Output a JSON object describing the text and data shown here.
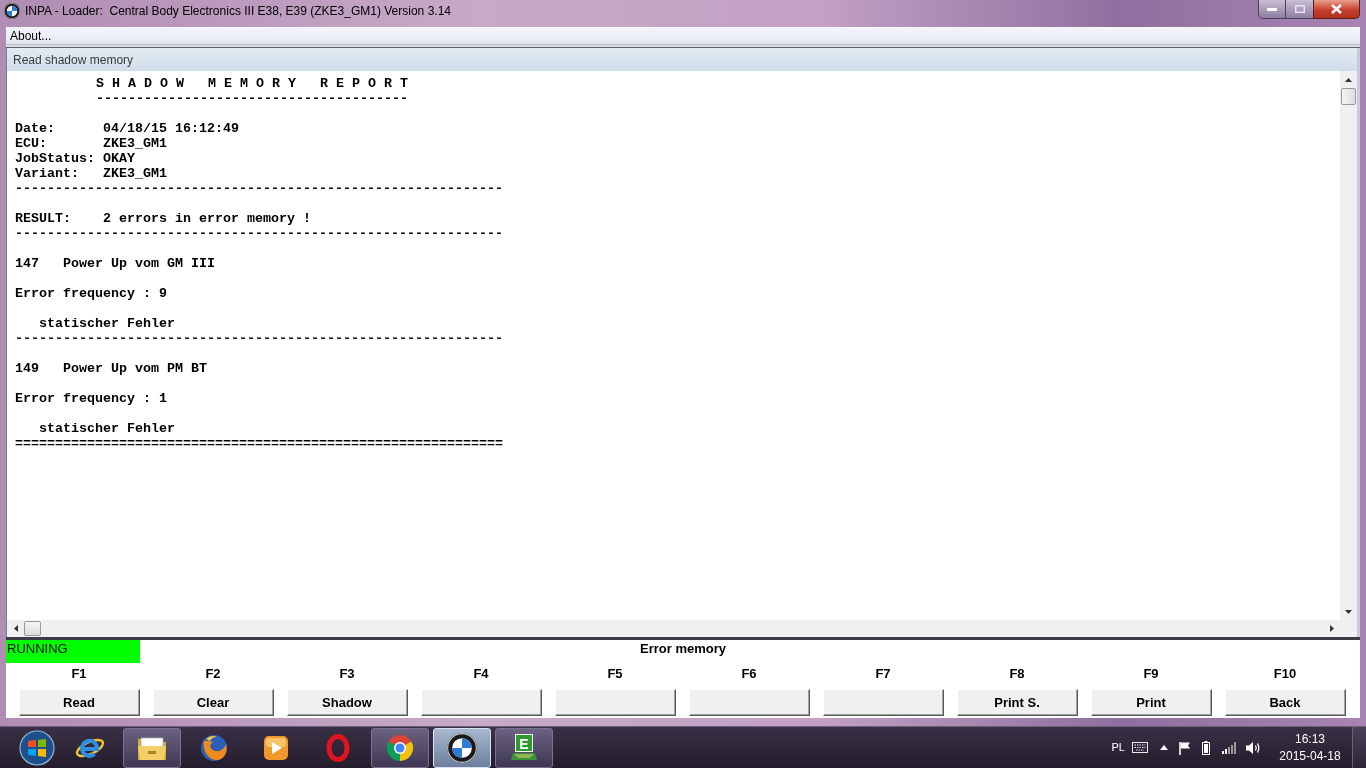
{
  "window": {
    "title": "INPA - Loader:  Central Body Electronics III E38, E39 (ZKE3_GM1) Version 3.14"
  },
  "menu": [
    {
      "label": "About..."
    }
  ],
  "child_window": {
    "title": "Read shadow memory"
  },
  "report": {
    "title": "S H A D O W   M E M O R Y   R E P O R T",
    "title_underline": "---------------------------------------",
    "fields": [
      {
        "label": "Date:",
        "value": "04/18/15 16:12:49"
      },
      {
        "label": "ECU:",
        "value": "ZKE3_GM1"
      },
      {
        "label": "JobStatus:",
        "value": "OKAY"
      },
      {
        "label": "Variant:",
        "value": "ZKE3_GM1"
      }
    ],
    "fields_rule": "-------------------------------------------------------------",
    "result": {
      "label": "RESULT:",
      "value": "2 errors in error memory !"
    },
    "result_rule": "-------------------------------------------------------------",
    "errors": [
      {
        "code": "147",
        "text": "Power Up vom GM III",
        "frequency": "Error frequency : 9",
        "note": "statischer Fehler",
        "rule": "-------------------------------------------------------------"
      },
      {
        "code": "149",
        "text": "Power Up vom PM BT",
        "frequency": "Error frequency : 1",
        "note": "statischer Fehler",
        "rule": "============================================================="
      }
    ]
  },
  "status": {
    "label": "RUNNING"
  },
  "function_panel": {
    "title": "Error memory",
    "keys": [
      {
        "key": "F1",
        "label": "Read"
      },
      {
        "key": "F2",
        "label": "Clear"
      },
      {
        "key": "F3",
        "label": "Shadow"
      },
      {
        "key": "F4"
      },
      {
        "key": "F5"
      },
      {
        "key": "F6"
      },
      {
        "key": "F7"
      },
      {
        "key": "F8",
        "label": "Print S."
      },
      {
        "key": "F9",
        "label": "Print"
      },
      {
        "key": "F10",
        "label": "Back"
      }
    ]
  },
  "taskbar": {
    "buttons": [
      {
        "running": false,
        "selected": false
      },
      {
        "running": true,
        "selected": false
      },
      {
        "running": false,
        "selected": false
      },
      {
        "running": false,
        "selected": false
      },
      {
        "running": false,
        "selected": false
      },
      {
        "running": true,
        "selected": false
      },
      {
        "running": true,
        "selected": true
      },
      {
        "running": true,
        "selected": false,
        "label": "E"
      }
    ],
    "language": "PL",
    "time": "16:13",
    "date": "2015-04-18"
  }
}
